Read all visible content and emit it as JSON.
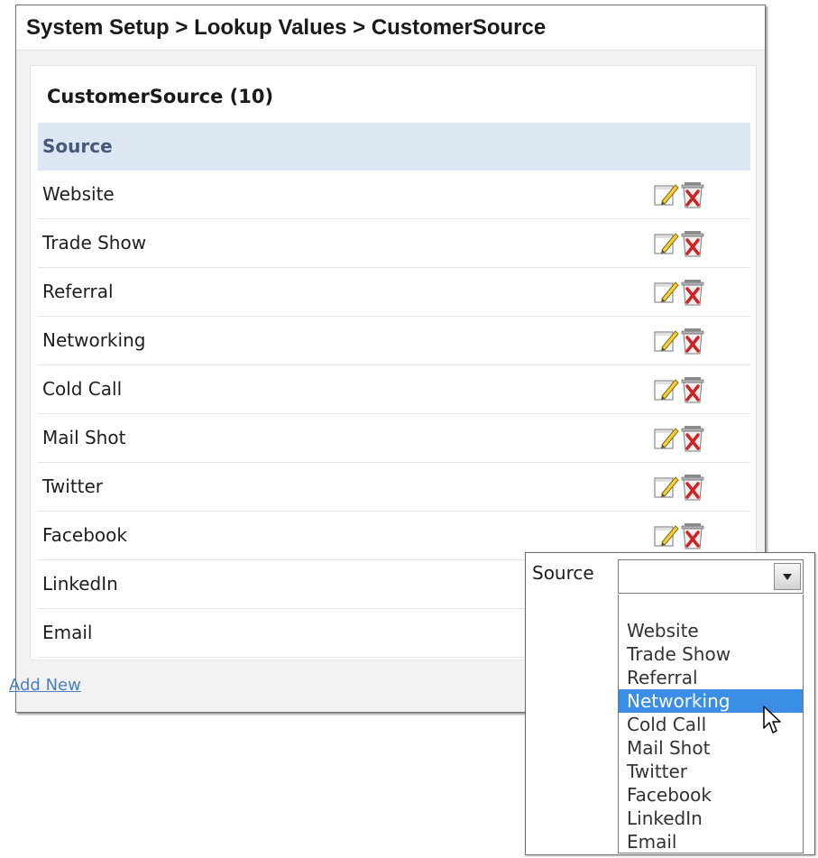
{
  "breadcrumb": "System Setup > Lookup Values > CustomerSource",
  "section_title": "CustomerSource (10)",
  "table": {
    "column_header": "Source",
    "rows": [
      "Website",
      "Trade Show",
      "Referral",
      "Networking",
      "Cold Call",
      "Mail Shot",
      "Twitter",
      "Facebook",
      "LinkedIn",
      "Email"
    ]
  },
  "icons": {
    "edit": "edit-icon",
    "delete": "delete-icon"
  },
  "add_new_label": "Add New",
  "dropdown": {
    "label": "Source",
    "selected_value": "",
    "highlighted": "Networking",
    "options": [
      "",
      "Website",
      "Trade Show",
      "Referral",
      "Networking",
      "Cold Call",
      "Mail Shot",
      "Twitter",
      "Facebook",
      "LinkedIn",
      "Email"
    ]
  },
  "colors": {
    "header_bg": "#dde7f3",
    "link": "#4a7fc1",
    "highlight": "#3a8ee6",
    "delete_red": "#d42020"
  }
}
